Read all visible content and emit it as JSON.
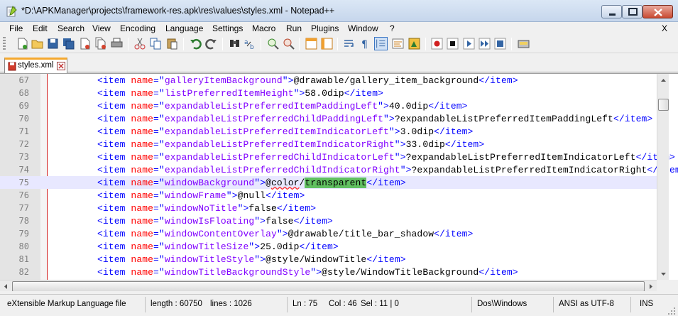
{
  "window": {
    "title": "*D:\\APKManager\\projects\\framework-res.apk\\res\\values\\styles.xml - Notepad++"
  },
  "menu": {
    "items": [
      "File",
      "Edit",
      "Search",
      "View",
      "Encoding",
      "Language",
      "Settings",
      "Macro",
      "Run",
      "Plugins",
      "Window",
      "?"
    ],
    "close_label": "X"
  },
  "toolbar": {
    "buttons": [
      "new-file-icon",
      "open-file-icon",
      "save-icon",
      "save-all-icon",
      "close-icon",
      "close-all-icon",
      "print-icon",
      "cut-icon",
      "copy-icon",
      "paste-icon",
      "undo-icon",
      "redo-icon",
      "find-icon",
      "replace-icon",
      "zoom-in-icon",
      "zoom-out-icon",
      "sync-vertical-icon",
      "sync-horizontal-icon",
      "word-wrap-icon",
      "show-all-chars-icon",
      "indent-guide-icon",
      "user-lang-icon",
      "doc-map-icon",
      "record-macro-icon",
      "stop-macro-icon",
      "play-macro-icon",
      "run-macro-multiple-icon",
      "save-macro-icon",
      "trim-icon"
    ]
  },
  "tabs": [
    {
      "label": "styles.xml",
      "modified": true
    }
  ],
  "editor": {
    "lines": [
      {
        "num": "67",
        "name": "galleryItemBackground",
        "value": "@drawable/gallery_item_background",
        "current": false
      },
      {
        "num": "68",
        "name": "listPreferredItemHeight",
        "value": "58.0dip",
        "current": false
      },
      {
        "num": "69",
        "name": "expandableListPreferredItemPaddingLeft",
        "value": "40.0dip",
        "current": false
      },
      {
        "num": "70",
        "name": "expandableListPreferredChildPaddingLeft",
        "value": "?expandableListPreferredItemPaddingLeft",
        "current": false
      },
      {
        "num": "71",
        "name": "expandableListPreferredItemIndicatorLeft",
        "value": "3.0dip",
        "current": false
      },
      {
        "num": "72",
        "name": "expandableListPreferredItemIndicatorRight",
        "value": "33.0dip",
        "current": false
      },
      {
        "num": "73",
        "name": "expandableListPreferredChildIndicatorLeft",
        "value": "?expandableListPreferredItemIndicatorLeft",
        "current": false
      },
      {
        "num": "74",
        "name": "expandableListPreferredChildIndicatorRight",
        "value": "?expandableListPreferredItemIndicatorRight",
        "current": false
      },
      {
        "num": "75",
        "name": "windowBackground",
        "value_pre": "@",
        "value_squiggle": "color",
        "value_mid": "/",
        "value_selected": "transparent",
        "current": true
      },
      {
        "num": "76",
        "name": "windowFrame",
        "value": "@null",
        "current": false
      },
      {
        "num": "77",
        "name": "windowNoTitle",
        "value": "false",
        "current": false
      },
      {
        "num": "78",
        "name": "windowIsFloating",
        "value": "false",
        "current": false
      },
      {
        "num": "79",
        "name": "windowContentOverlay",
        "value": "@drawable/title_bar_shadow",
        "current": false
      },
      {
        "num": "80",
        "name": "windowTitleSize",
        "value": "25.0dip",
        "current": false
      },
      {
        "num": "81",
        "name": "windowTitleStyle",
        "value": "@style/WindowTitle",
        "current": false
      },
      {
        "num": "82",
        "name": "windowTitleBackgroundStyle",
        "value": "@style/WindowTitleBackground",
        "current": false
      }
    ]
  },
  "status": {
    "file_type": "eXtensible Markup Language file",
    "length": "length : 60750",
    "lines": "lines : 1026",
    "ln": "Ln : 75",
    "col": "Col : 46",
    "sel": "Sel : 11 | 0",
    "eol": "Dos\\Windows",
    "encoding": "ANSI as UTF-8",
    "mode": "INS"
  },
  "colors": {
    "tag": "#0000ff",
    "attribute": "#ff0000",
    "attribute_value": "#8000ff",
    "selection": "#60c060",
    "current_line": "#e8e8ff",
    "tab_accent": "#f4a82e"
  }
}
